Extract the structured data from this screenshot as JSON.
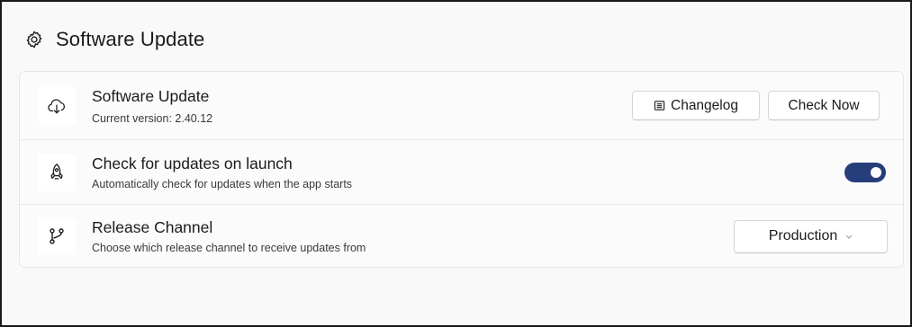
{
  "header": {
    "icon": "gear-icon",
    "title": "Software Update"
  },
  "rows": {
    "software_update": {
      "icon": "cloud-download-icon",
      "title": "Software Update",
      "subtitle": "Current version: 2.40.12",
      "changelog_icon": "document-list-icon",
      "changelog_label": "Changelog",
      "check_now_label": "Check Now"
    },
    "check_on_launch": {
      "icon": "rocket-icon",
      "title": "Check for updates on launch",
      "subtitle": "Automatically check for updates when the app starts",
      "toggle_on": true,
      "toggle_color": "#253e7a"
    },
    "release_channel": {
      "icon": "branch-icon",
      "title": "Release Channel",
      "subtitle": "Choose which release channel to receive updates from",
      "selected": "Production",
      "chevron_icon": "chevron-down-icon"
    }
  }
}
